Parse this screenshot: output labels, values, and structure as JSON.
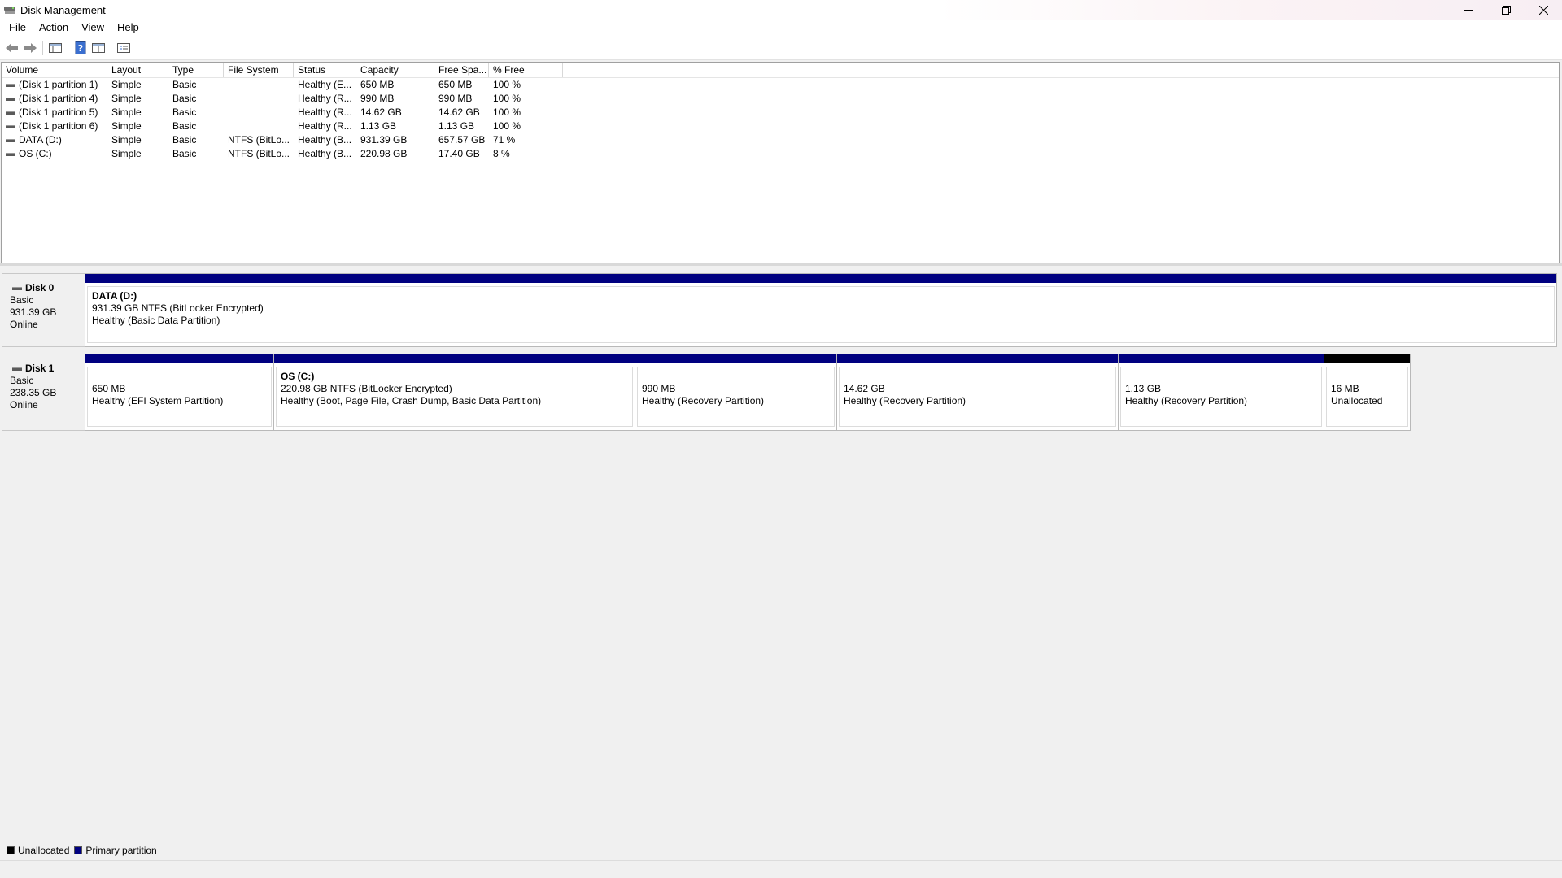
{
  "window": {
    "title": "Disk Management"
  },
  "menu": {
    "items": [
      "File",
      "Action",
      "View",
      "Help"
    ]
  },
  "toolbar": {
    "buttons": [
      "back-icon",
      "forward-icon",
      "show-hide-console-tree-icon",
      "help-icon",
      "properties-icon",
      "settings-icon"
    ]
  },
  "volume_list": {
    "columns": [
      "Volume",
      "Layout",
      "Type",
      "File System",
      "Status",
      "Capacity",
      "Free Spa...",
      "% Free"
    ],
    "rows": [
      {
        "volume": "(Disk 1 partition 1)",
        "layout": "Simple",
        "type": "Basic",
        "fs": "",
        "status": "Healthy (E...",
        "capacity": "650 MB",
        "free": "650 MB",
        "pct": "100 %"
      },
      {
        "volume": "(Disk 1 partition 4)",
        "layout": "Simple",
        "type": "Basic",
        "fs": "",
        "status": "Healthy (R...",
        "capacity": "990 MB",
        "free": "990 MB",
        "pct": "100 %"
      },
      {
        "volume": "(Disk 1 partition 5)",
        "layout": "Simple",
        "type": "Basic",
        "fs": "",
        "status": "Healthy (R...",
        "capacity": "14.62 GB",
        "free": "14.62 GB",
        "pct": "100 %"
      },
      {
        "volume": "(Disk 1 partition 6)",
        "layout": "Simple",
        "type": "Basic",
        "fs": "",
        "status": "Healthy (R...",
        "capacity": "1.13 GB",
        "free": "1.13 GB",
        "pct": "100 %"
      },
      {
        "volume": "DATA (D:)",
        "layout": "Simple",
        "type": "Basic",
        "fs": "NTFS (BitLo...",
        "status": "Healthy (B...",
        "capacity": "931.39 GB",
        "free": "657.57 GB",
        "pct": "71 %"
      },
      {
        "volume": "OS (C:)",
        "layout": "Simple",
        "type": "Basic",
        "fs": "NTFS (BitLo...",
        "status": "Healthy (B...",
        "capacity": "220.98 GB",
        "free": "17.40 GB",
        "pct": "8 %"
      }
    ]
  },
  "disks": [
    {
      "name": "Disk 0",
      "type": "Basic",
      "size": "931.39 GB",
      "state": "Online",
      "partitions": [
        {
          "name": "DATA  (D:)",
          "line1": "931.39 GB NTFS (BitLocker Encrypted)",
          "line2": "Healthy (Basic Data Partition)",
          "kind": "primary"
        }
      ]
    },
    {
      "name": "Disk 1",
      "type": "Basic",
      "size": "238.35 GB",
      "state": "Online",
      "partitions": [
        {
          "name": "",
          "line1": "650 MB",
          "line2": "Healthy (EFI System Partition)",
          "kind": "primary"
        },
        {
          "name": "OS  (C:)",
          "line1": "220.98 GB NTFS (BitLocker Encrypted)",
          "line2": "Healthy (Boot, Page File, Crash Dump, Basic Data Partition)",
          "kind": "primary"
        },
        {
          "name": "",
          "line1": "990 MB",
          "line2": "Healthy (Recovery Partition)",
          "kind": "primary"
        },
        {
          "name": "",
          "line1": "14.62 GB",
          "line2": "Healthy (Recovery Partition)",
          "kind": "primary"
        },
        {
          "name": "",
          "line1": "1.13 GB",
          "line2": "Healthy (Recovery Partition)",
          "kind": "primary"
        },
        {
          "name": "",
          "line1": "16 MB",
          "line2": "Unallocated",
          "kind": "unallocated"
        }
      ]
    }
  ],
  "legend": {
    "unallocated": "Unallocated",
    "primary": "Primary partition"
  },
  "colors": {
    "primary_partition": "#000080",
    "unallocated": "#000000"
  }
}
